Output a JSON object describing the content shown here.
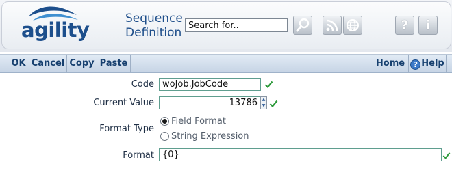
{
  "header": {
    "logo_text": "agility",
    "title_line1": "Sequence",
    "title_line2": "Definition",
    "search": {
      "value": "Search for.."
    },
    "icons": [
      "search-icon",
      "rss-icon",
      "globe-icon",
      "help-icon",
      "info-icon"
    ],
    "help_glyph": "?",
    "info_glyph": "i"
  },
  "toolbar": {
    "ok": "OK",
    "cancel": "Cancel",
    "copy": "Copy",
    "paste": "Paste",
    "home": "Home",
    "help": "Help"
  },
  "form": {
    "code": {
      "label": "Code",
      "value": "woJob.JobCode"
    },
    "current_value": {
      "label": "Current Value",
      "value": "13786"
    },
    "format_type": {
      "label": "Format Type",
      "options": [
        "Field Format",
        "String Expression"
      ],
      "selected": "Field Format"
    },
    "format": {
      "label": "Format",
      "value": "{0}"
    }
  },
  "colors": {
    "brand_blue": "#1d4f8c",
    "valid_check": "#2e9a3c",
    "toolbar_text": "#17406f"
  }
}
